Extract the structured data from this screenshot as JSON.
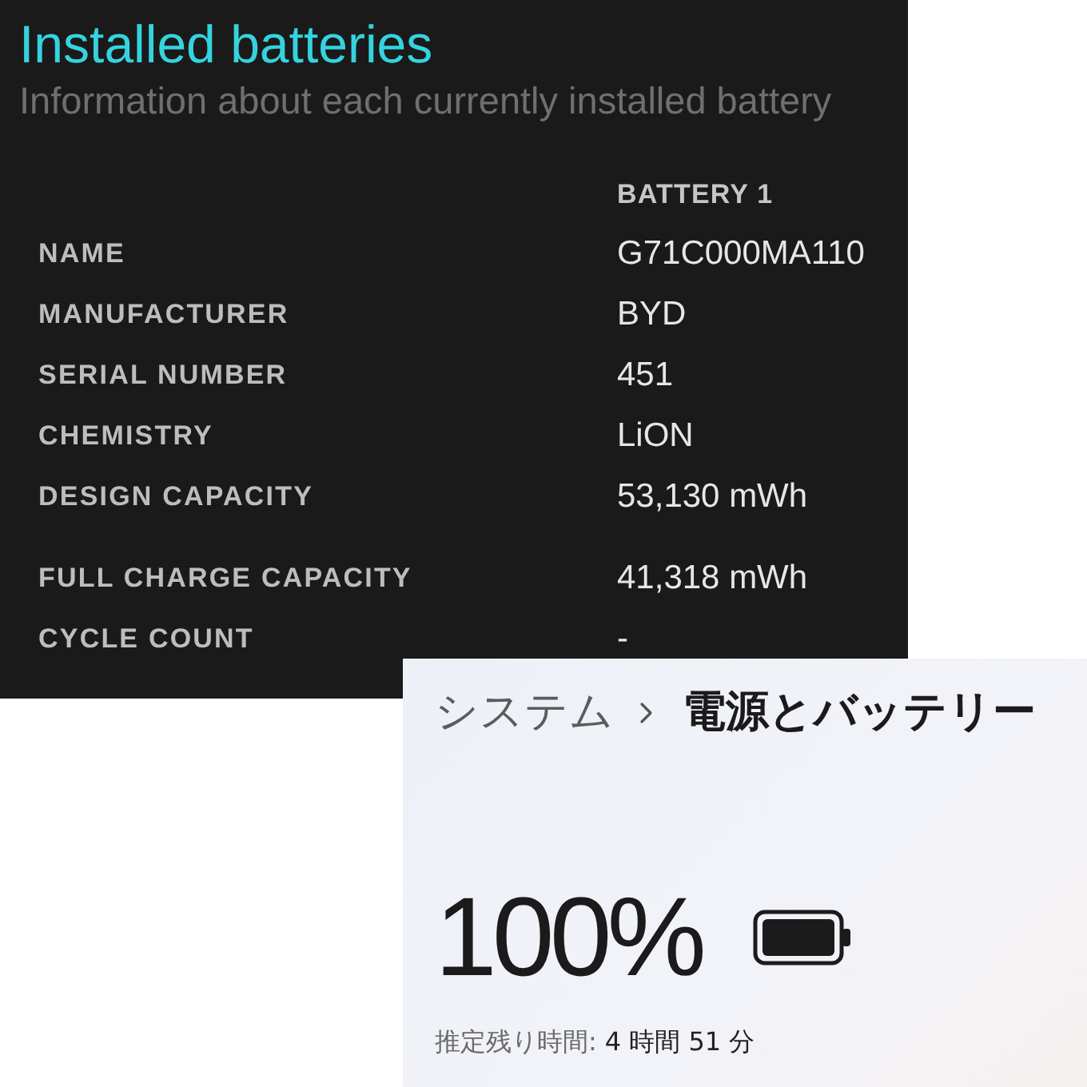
{
  "battery_report": {
    "title": "Installed batteries",
    "subtitle": "Information about each currently installed battery",
    "columns": [
      "BATTERY 1"
    ],
    "row_groups": [
      {
        "rows": [
          {
            "label": "NAME",
            "value": "G71C000MA110"
          },
          {
            "label": "MANUFACTURER",
            "value": "BYD"
          },
          {
            "label": "SERIAL NUMBER",
            "value": "451"
          },
          {
            "label": "CHEMISTRY",
            "value": "LiON"
          },
          {
            "label": "DESIGN CAPACITY",
            "value": "53,130 mWh"
          }
        ]
      },
      {
        "rows": [
          {
            "label": "FULL CHARGE CAPACITY",
            "value": "41,318 mWh"
          },
          {
            "label": "CYCLE COUNT",
            "value": "-"
          }
        ]
      }
    ]
  },
  "power_settings": {
    "breadcrumb": [
      {
        "label": "システム",
        "current": false
      },
      {
        "label": "電源とバッテリー",
        "current": true
      }
    ],
    "charge": "100%",
    "estimate": {
      "label": "推定残り時間:",
      "value": "4 時間 51 分"
    }
  }
}
